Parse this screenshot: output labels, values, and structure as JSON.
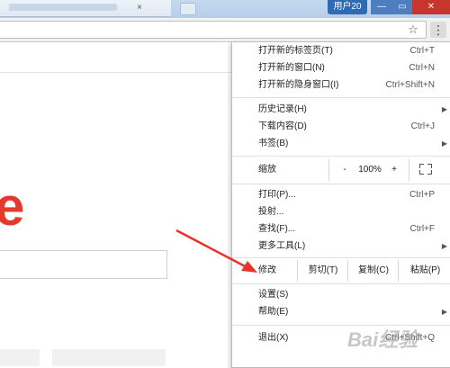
{
  "titlebar": {
    "user_label": "用户20",
    "tab_close_glyph": "×",
    "min_glyph": "—",
    "max_glyph": "▭",
    "close_glyph": "✕"
  },
  "toolbar": {
    "star_glyph": "☆",
    "menu_glyph": "⋮"
  },
  "page": {
    "logo_fragment": "e",
    "logo_color": "#e23b2e"
  },
  "menu": {
    "new_tab": {
      "label": "打开新的标签页(T)",
      "shortcut": "Ctrl+T"
    },
    "new_window": {
      "label": "打开新的窗口(N)",
      "shortcut": "Ctrl+N"
    },
    "new_incognito": {
      "label": "打开新的隐身窗口(I)",
      "shortcut": "Ctrl+Shift+N"
    },
    "history": {
      "label": "历史记录(H)",
      "arrow": "▶"
    },
    "downloads": {
      "label": "下载内容(D)",
      "shortcut": "Ctrl+J"
    },
    "bookmarks": {
      "label": "书签(B)",
      "arrow": "▶"
    },
    "zoom": {
      "label": "缩放",
      "minus": "-",
      "value": "100%",
      "plus": "+"
    },
    "print": {
      "label": "打印(P)...",
      "shortcut": "Ctrl+P"
    },
    "cast": {
      "label": "投射..."
    },
    "find": {
      "label": "查找(F)...",
      "shortcut": "Ctrl+F"
    },
    "more_tools": {
      "label": "更多工具(L)",
      "arrow": "▶"
    },
    "edit": {
      "label": "修改",
      "cut": "剪切(T)",
      "copy": "复制(C)",
      "paste": "粘贴(P)"
    },
    "settings": {
      "label": "设置(S)"
    },
    "help": {
      "label": "帮助(E)",
      "arrow": "▶"
    },
    "exit": {
      "label": "退出(X)",
      "shortcut": "Ctrl+Shift+Q"
    }
  },
  "annotation": {
    "arrow_color": "#e8332a",
    "watermark": "Bai经验"
  }
}
